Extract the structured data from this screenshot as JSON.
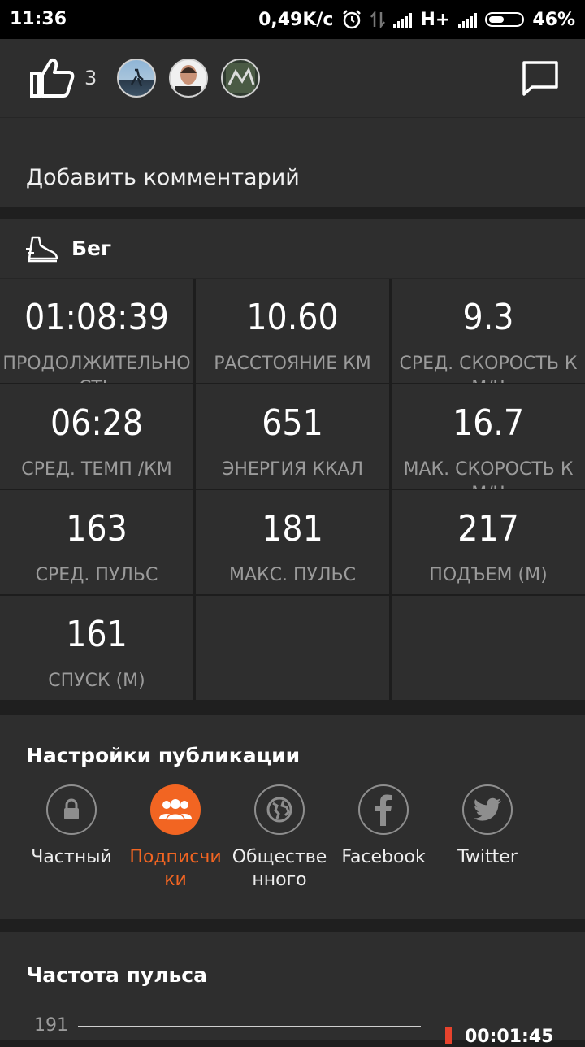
{
  "status_bar": {
    "time": "11:36",
    "net_speed": "0,49K/c",
    "network": "H+",
    "battery": "46%"
  },
  "social": {
    "like_count": "3",
    "icons": [
      "like-icon",
      "comment-icon"
    ]
  },
  "comment": {
    "placeholder": "Добавить комментарий"
  },
  "activity": {
    "sport": "Бег",
    "icon": "running-shoe-icon"
  },
  "stats": [
    {
      "value": "01:08:39",
      "label": "ПРОДОЛЖИТЕЛЬНОСТЬ"
    },
    {
      "value": "10.60",
      "label": "РАССТОЯНИЕ КМ"
    },
    {
      "value": "9.3",
      "label": "СРЕД. СКОРОСТЬ КМ/Ч"
    },
    {
      "value": "06:28",
      "label": "СРЕД. ТЕМП /КМ"
    },
    {
      "value": "651",
      "label": "ЭНЕРГИЯ ККАЛ"
    },
    {
      "value": "16.7",
      "label": "МАК. СКОРОСТЬ КМ/Ч"
    },
    {
      "value": "163",
      "label": "СРЕД. ПУЛЬС"
    },
    {
      "value": "181",
      "label": "МАКС. ПУЛЬС"
    },
    {
      "value": "217",
      "label": "ПОДЪЕМ (М)"
    },
    {
      "value": "161",
      "label": "СПУСК (М)"
    }
  ],
  "publish": {
    "title": "Настройки публикации",
    "options": [
      {
        "label": "Частный",
        "icon": "lock-icon",
        "selected": false
      },
      {
        "label": "Подписчики",
        "icon": "followers-icon",
        "selected": true
      },
      {
        "label": "Общественного",
        "icon": "globe-icon",
        "selected": false
      },
      {
        "label": "Facebook",
        "icon": "facebook-icon",
        "selected": false
      },
      {
        "label": "Twitter",
        "icon": "twitter-icon",
        "selected": false
      }
    ],
    "accent": "#f26522"
  },
  "heart_rate": {
    "title": "Частота пульса",
    "y_max": "191",
    "time": "00:01:45"
  }
}
